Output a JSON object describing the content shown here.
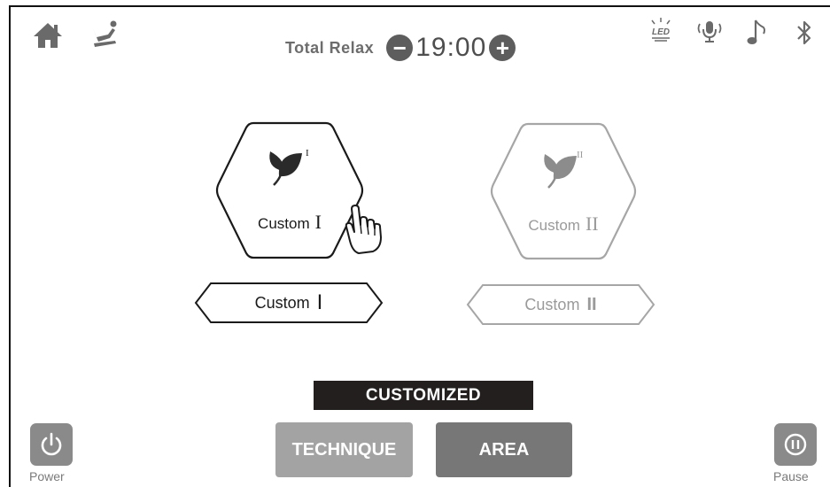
{
  "top_bar": {
    "left_icons": [
      "home-icon",
      "recline-chair-icon"
    ],
    "right_icons": [
      "led-icon",
      "voice-icon",
      "music-icon",
      "bluetooth-icon"
    ],
    "led_text": "LED"
  },
  "timer": {
    "label": "Total  Relax",
    "value": "19:00",
    "decrease_symbol": "−",
    "increase_symbol": "+"
  },
  "programs": [
    {
      "label": "Custom",
      "numeral": "I",
      "sup": "I",
      "state": "selected",
      "icon": "leaf-icon",
      "pill_label": "Custom",
      "pill_numeral": "I"
    },
    {
      "label": "Custom",
      "numeral": "II",
      "sup": "II",
      "state": "inactive",
      "icon": "leaf-icon",
      "pill_label": "Custom",
      "pill_numeral": "II"
    }
  ],
  "mode_bar": {
    "title": "CUSTOMIZED"
  },
  "tabs": [
    {
      "label": "TECHNIQUE",
      "color": "#a3a3a3"
    },
    {
      "label": "AREA",
      "color": "#777777"
    }
  ],
  "power": {
    "label": "Power",
    "icon": "power-icon"
  },
  "pause": {
    "label": "Pause",
    "icon": "pause-icon"
  },
  "colors": {
    "active": "#1a1a1a",
    "inactive": "#a6a6a6",
    "icon_gray": "#6a6a6a"
  }
}
